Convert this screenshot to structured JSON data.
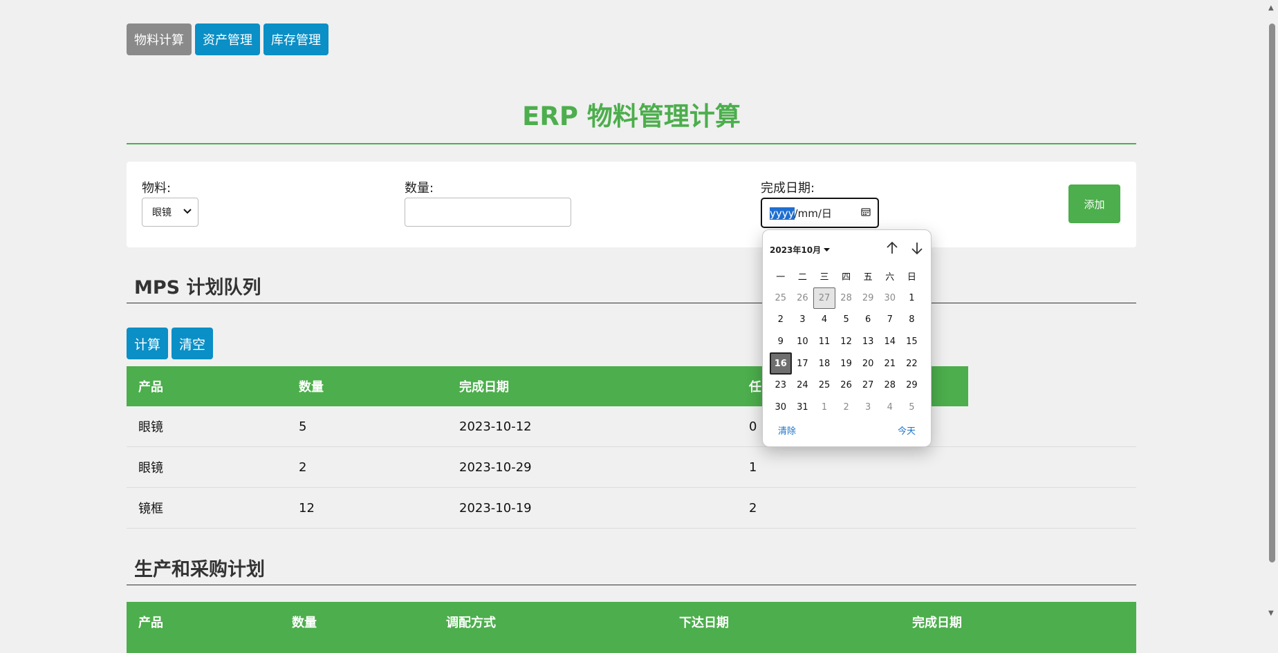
{
  "nav": {
    "items": [
      {
        "label": "物料计算",
        "active": true
      },
      {
        "label": "资产管理",
        "active": false
      },
      {
        "label": "库存管理",
        "active": false
      }
    ]
  },
  "page": {
    "title": "ERP 物料管理计算"
  },
  "form": {
    "material_label": "物料:",
    "material_value": "眼镜",
    "quantity_label": "数量:",
    "quantity_value": "",
    "date_label": "完成日期:",
    "date_year": "yyyy",
    "date_sep1": "/",
    "date_month": "mm",
    "date_sep2": "/",
    "date_day": "日",
    "add_label": "添加"
  },
  "mps": {
    "title": "MPS 计划队列",
    "calc_label": "计算",
    "clear_label": "清空",
    "columns": [
      "产品",
      "数量",
      "完成日期",
      "任"
    ],
    "rows": [
      [
        "眼镜",
        "5",
        "2023-10-12",
        "0"
      ],
      [
        "眼镜",
        "2",
        "2023-10-29",
        "1"
      ],
      [
        "镜框",
        "12",
        "2023-10-19",
        "2"
      ]
    ]
  },
  "plan": {
    "title": "生产和采购计划",
    "columns": [
      "产品",
      "数量",
      "调配方式",
      "下达日期",
      "完成日期"
    ]
  },
  "calendar": {
    "month_label": "2023年10月",
    "weekdays": [
      "一",
      "二",
      "三",
      "四",
      "五",
      "六",
      "日"
    ],
    "days": [
      "25",
      "26",
      "27",
      "28",
      "29",
      "30",
      "1",
      "2",
      "3",
      "4",
      "5",
      "6",
      "7",
      "8",
      "9",
      "10",
      "11",
      "12",
      "13",
      "14",
      "15",
      "16",
      "17",
      "18",
      "19",
      "20",
      "21",
      "22",
      "23",
      "24",
      "25",
      "26",
      "27",
      "28",
      "29",
      "30",
      "31",
      "1",
      "2",
      "3",
      "4",
      "5"
    ],
    "clear_label": "清除",
    "today_label": "今天"
  },
  "colors": {
    "accent_green": "#4cae4c",
    "nav_blue": "#0a8fc6",
    "nav_active_gray": "#8a8a8a"
  }
}
